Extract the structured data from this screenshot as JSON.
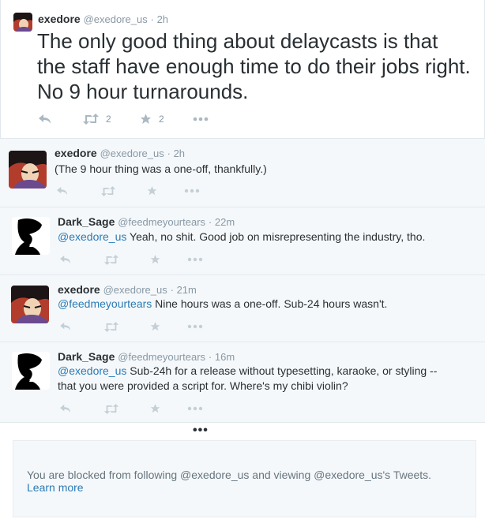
{
  "main_tweet": {
    "name": "exedore",
    "handle": "@exedore_us",
    "time": "2h",
    "text": "The only good thing about delaycasts is that the staff have enough time to do their jobs right. No 9 hour turnarounds.",
    "retweet_count": "2",
    "favorite_count": "2"
  },
  "replies": [
    {
      "name": "exedore",
      "handle": "@exedore_us",
      "time": "2h",
      "mention": "",
      "text": "(The 9 hour thing was a one-off, thankfully.)"
    },
    {
      "name": "Dark_Sage",
      "handle": "@feedmeyourtears",
      "time": "22m",
      "mention": "@exedore_us",
      "text": " Yeah, no shit. Good job on misrepresenting the industry, tho."
    },
    {
      "name": "exedore",
      "handle": "@exedore_us",
      "time": "21m",
      "mention": "@feedmeyourtears",
      "text": " Nine hours was a one-off. Sub-24 hours wasn't."
    },
    {
      "name": "Dark_Sage",
      "handle": "@feedmeyourtears",
      "time": "16m",
      "mention": "@exedore_us",
      "text": " Sub-24h for a release without typesetting, karaoke, or styling -- that you were provided a script for. Where's my chibi violin?"
    }
  ],
  "more_indicator": "•••",
  "blocked_notice": {
    "text": "You are blocked from following @exedore_us and viewing @exedore_us's Tweets.",
    "link": "Learn more"
  },
  "icons": {
    "reply": "reply-icon",
    "retweet": "retweet-icon",
    "favorite": "star-icon",
    "more": "more-icon"
  },
  "colors": {
    "link": "#2a7bb5",
    "muted": "#8899a6",
    "card_bg": "#f5f8fa",
    "border": "#e1e8ed"
  }
}
